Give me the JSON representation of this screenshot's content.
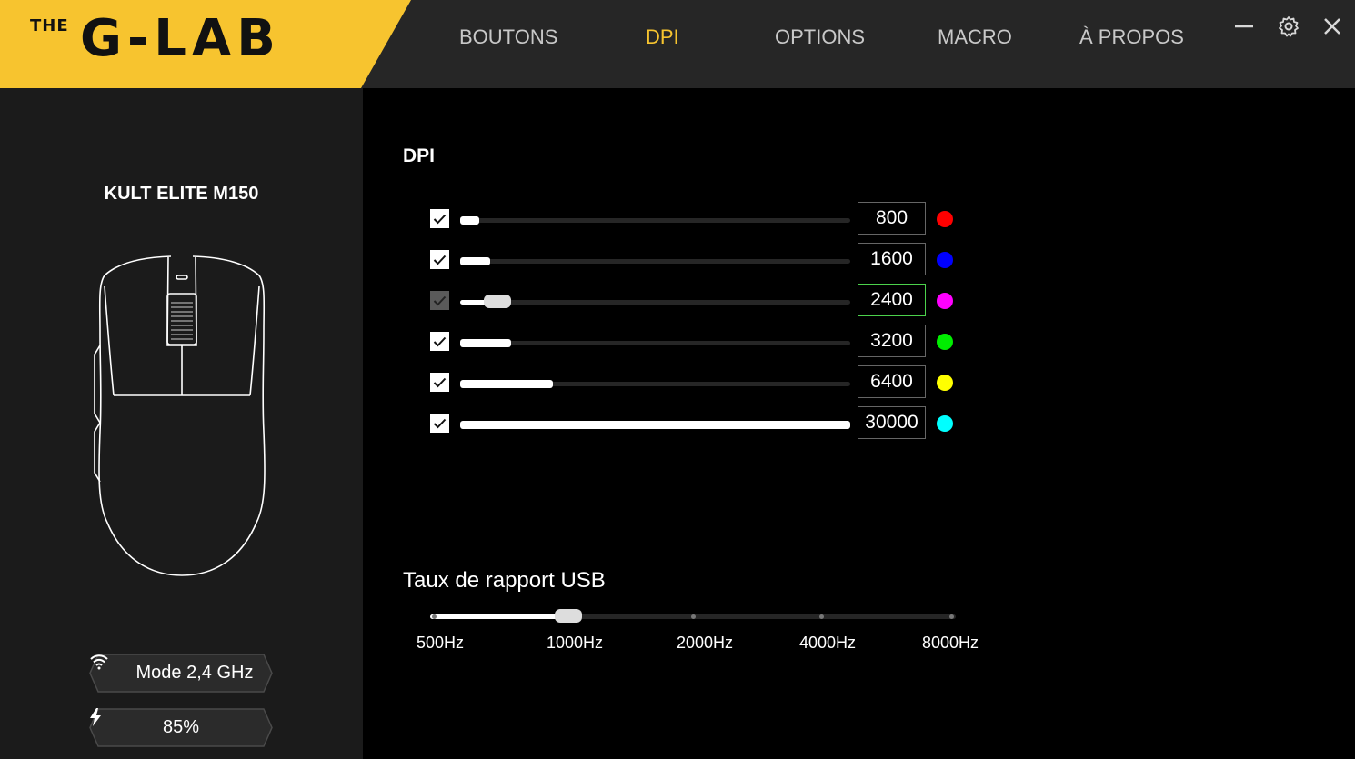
{
  "brand": {
    "the": "THE",
    "name": "G-LAB",
    "color": "#f7c42f"
  },
  "nav": [
    {
      "label": "BOUTONS",
      "active": false
    },
    {
      "label": "DPI",
      "active": true
    },
    {
      "label": "OPTIONS",
      "active": false
    },
    {
      "label": "MACRO",
      "active": false
    },
    {
      "label": "À PROPOS",
      "active": false
    }
  ],
  "window_controls": [
    "minimize-icon",
    "gear-icon",
    "close-icon"
  ],
  "device": {
    "model": "KULT ELITE M150",
    "mode_label": "Mode 2,4 GHz",
    "battery_label": "85%"
  },
  "dpi": {
    "title": "DPI",
    "max": 30000,
    "levels": [
      {
        "value": "800",
        "enabled": true,
        "color": "#ff0000"
      },
      {
        "value": "1600",
        "enabled": true,
        "color": "#0000ff"
      },
      {
        "value": "2400",
        "enabled": true,
        "color": "#ff00ff",
        "selected": true
      },
      {
        "value": "3200",
        "enabled": true,
        "color": "#00ee00"
      },
      {
        "value": "6400",
        "enabled": true,
        "color": "#ffff00"
      },
      {
        "value": "30000",
        "enabled": true,
        "color": "#00ffff"
      }
    ]
  },
  "usb": {
    "title": "Taux de rapport USB",
    "options": [
      "500Hz",
      "1000Hz",
      "2000Hz",
      "4000Hz",
      "8000Hz"
    ],
    "selected": "1000Hz"
  }
}
